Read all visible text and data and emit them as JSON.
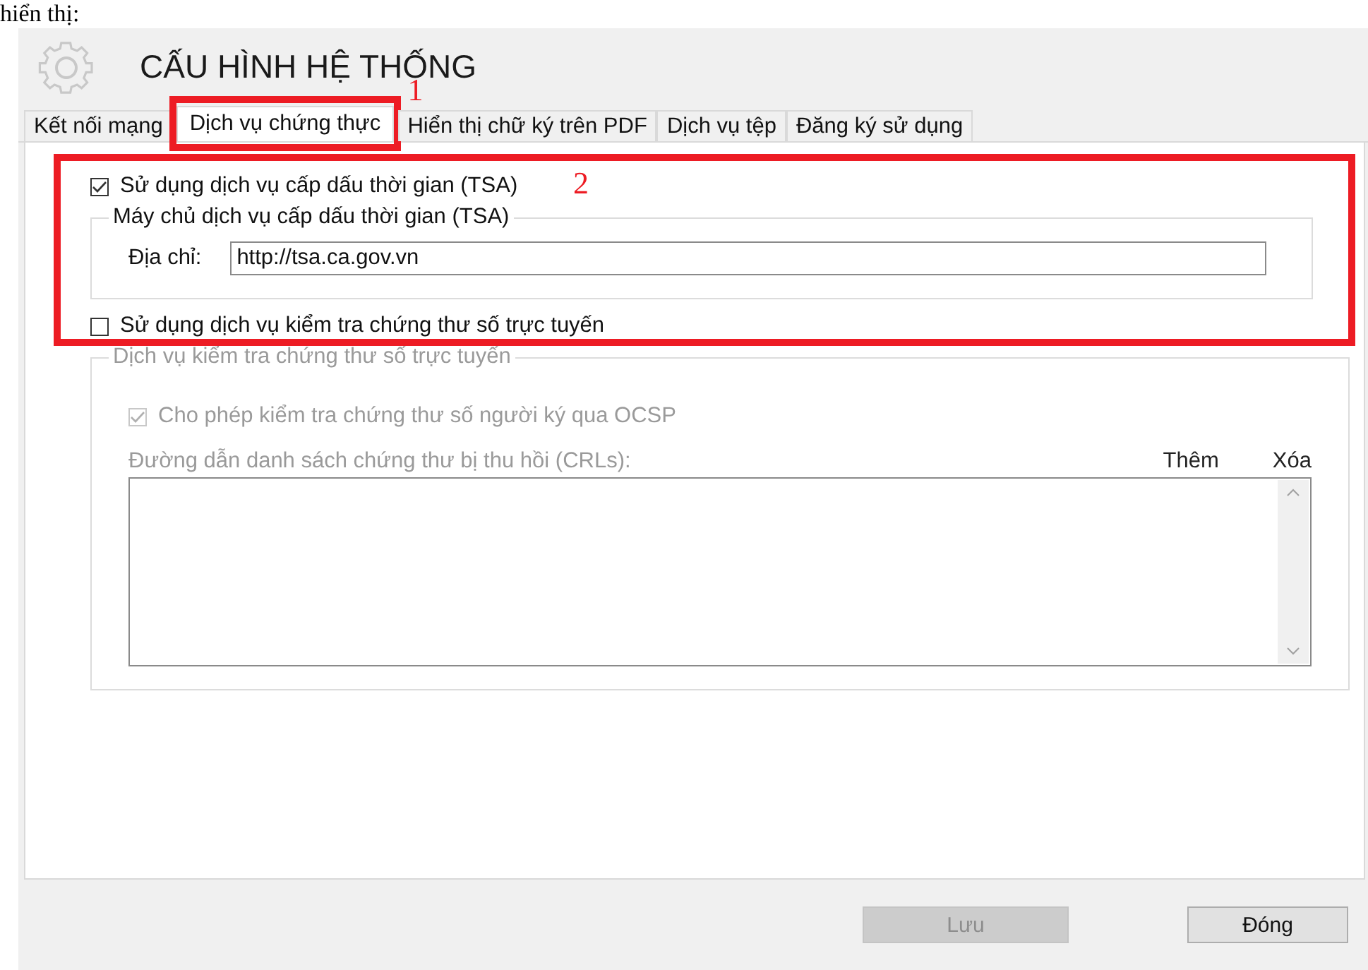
{
  "page_caption": "hiển thị:",
  "window": {
    "title": "CẤU HÌNH HỆ THỐNG"
  },
  "tabs": [
    {
      "label": "Kết nối mạng",
      "selected": false
    },
    {
      "label": "Dịch vụ chứng thực",
      "selected": true
    },
    {
      "label": "Hiển thị chữ ký trên PDF",
      "selected": false
    },
    {
      "label": "Dịch vụ tệp",
      "selected": false
    },
    {
      "label": "Đăng ký sử dụng",
      "selected": false
    }
  ],
  "tsa": {
    "label": "Sử dụng dịch vụ cấp dấu thời gian (TSA)",
    "checked": true,
    "group_title": "Máy chủ dịch vụ cấp dấu thời gian (TSA)",
    "address_label": "Địa chỉ:",
    "address_value": "http://tsa.ca.gov.vn"
  },
  "ocsp": {
    "label": "Sử dụng dịch vụ kiểm tra chứng thư số trực tuyến",
    "checked": false,
    "group_title": "Dịch vụ kiểm tra chứng thư số trực tuyến",
    "disabled": true,
    "allow_ocsp": {
      "label": "Cho phép kiểm tra chứng thư số người ký qua OCSP",
      "checked": true
    },
    "crl_label": "Đường dẫn danh sách chứng thư bị thu hồi (CRLs):",
    "add": "Thêm",
    "remove": "Xóa"
  },
  "buttons": [
    {
      "label": "Lưu",
      "disabled": true
    },
    {
      "label": "Đóng",
      "disabled": false
    }
  ],
  "annotations": [
    {
      "label": "1"
    },
    {
      "label": "2"
    }
  ]
}
